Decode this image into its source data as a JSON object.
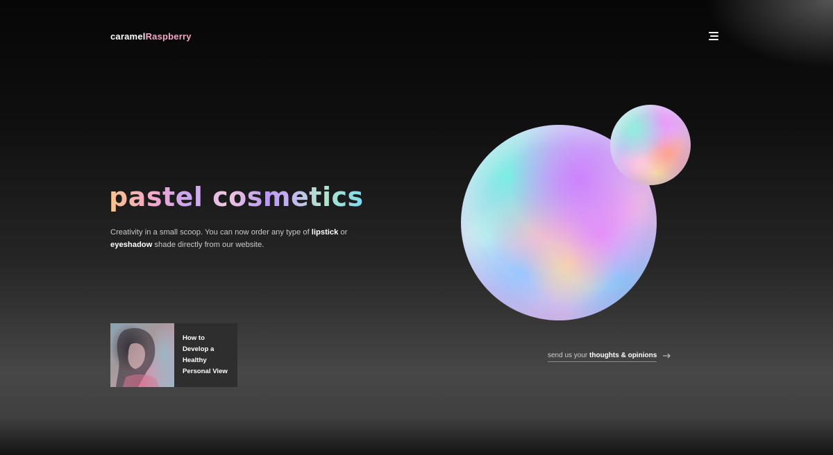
{
  "brand": {
    "part1": "caramel",
    "part2": "Raspberry"
  },
  "header": {
    "menu_icon": "hamburger-menu-icon"
  },
  "hero": {
    "title": "pastel cosmetics",
    "intro_1": "Creativity in a small scoop. You can now order any type of ",
    "intro_em1": "lipstick",
    "intro_2": " or ",
    "intro_em2": "eyeshadow",
    "intro_3": " shade directly from our website."
  },
  "article": {
    "title": "How to Develop a Healthy Personal View",
    "image": "woman-portrait-thumbnail"
  },
  "feedback": {
    "text_plain": "send us your ",
    "text_bold": "thoughts & opinions",
    "icon": "arrow-right-icon"
  },
  "colors": {
    "brand_accent": "#f3a6c8",
    "background_top": "#060606",
    "background_bottom": "#474747",
    "card_bg": "#2e2e2e"
  }
}
